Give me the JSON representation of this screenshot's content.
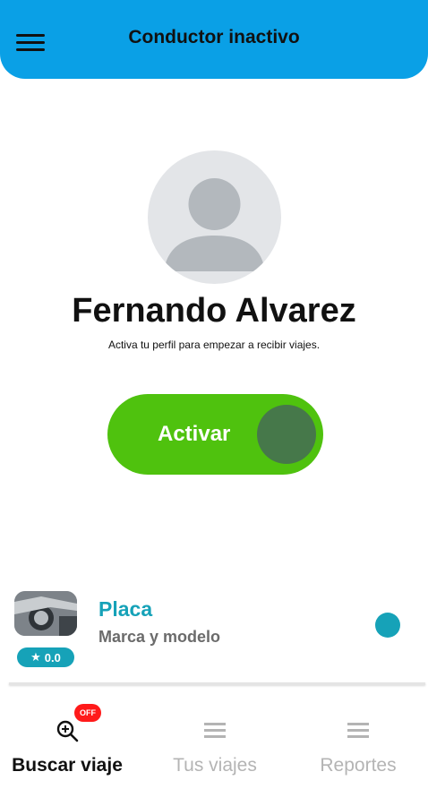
{
  "header": {
    "title": "Conductor inactivo",
    "menu_icon": "hamburger-menu-icon",
    "background_color": "#0aa0e6"
  },
  "profile": {
    "name": "Fernando Alvarez",
    "subtitle": "Activa tu perfil para empezar a recibir viajes.",
    "avatar_icon": "user-placeholder-icon"
  },
  "activate_toggle": {
    "label": "Activar",
    "state": "off",
    "color": "#4fc20e"
  },
  "vehicle": {
    "plate": "Placa",
    "model": "Marca y modelo",
    "rating": "0.0",
    "rating_icon": "star-icon",
    "accent_color": "#16a2b8"
  },
  "bottom_nav": {
    "items": [
      {
        "label": "Buscar viaje",
        "icon": "search-zoom-icon",
        "badge": "OFF",
        "active": true
      },
      {
        "label": "Tus viajes",
        "icon": "list-icon",
        "active": false
      },
      {
        "label": "Reportes",
        "icon": "list-icon",
        "active": false
      }
    ]
  }
}
